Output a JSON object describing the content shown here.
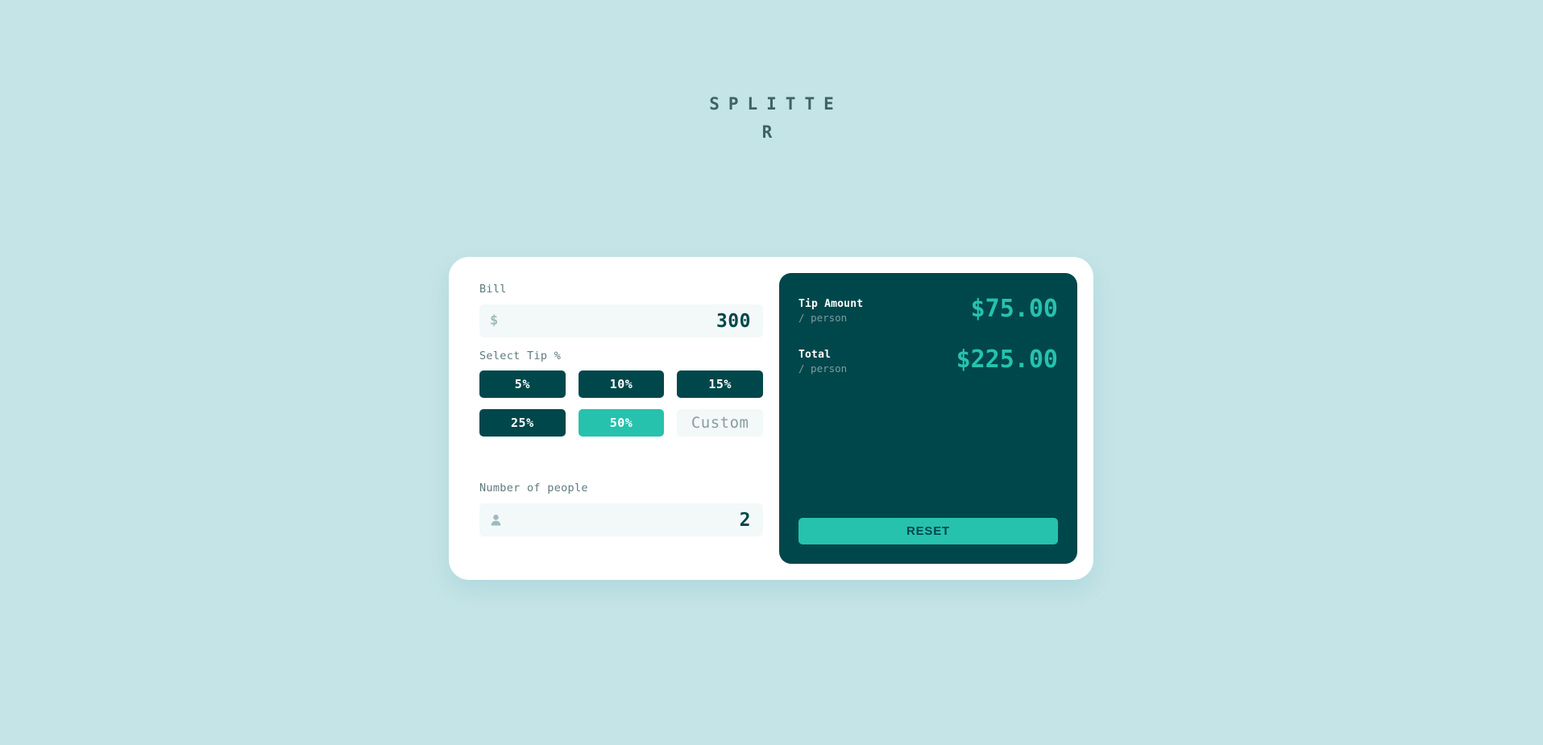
{
  "app": {
    "title": "SPLITTER",
    "background_color": "#c5e4e7",
    "card_color": "#ffffff",
    "accent_color": "#26c2ae",
    "dark_color": "#00474b"
  },
  "bill": {
    "label": "Bill",
    "icon": "dollar-icon",
    "currency_symbol": "$",
    "value": "300"
  },
  "tip": {
    "label": "Select Tip %",
    "options": [
      {
        "label": "5%",
        "value": 5,
        "active": false
      },
      {
        "label": "10%",
        "value": 10,
        "active": false
      },
      {
        "label": "15%",
        "value": 15,
        "active": false
      },
      {
        "label": "25%",
        "value": 25,
        "active": false
      },
      {
        "label": "50%",
        "value": 50,
        "active": true
      }
    ],
    "custom_placeholder": "Custom",
    "custom_value": ""
  },
  "people": {
    "label": "Number of people",
    "icon": "person-icon",
    "value": "2"
  },
  "results": {
    "rows": [
      {
        "title": "Tip Amount",
        "subtitle": "/ person",
        "amount": "$75.00"
      },
      {
        "title": "Total",
        "subtitle": "/ person",
        "amount": "$225.00"
      }
    ],
    "reset_label": "RESET"
  }
}
